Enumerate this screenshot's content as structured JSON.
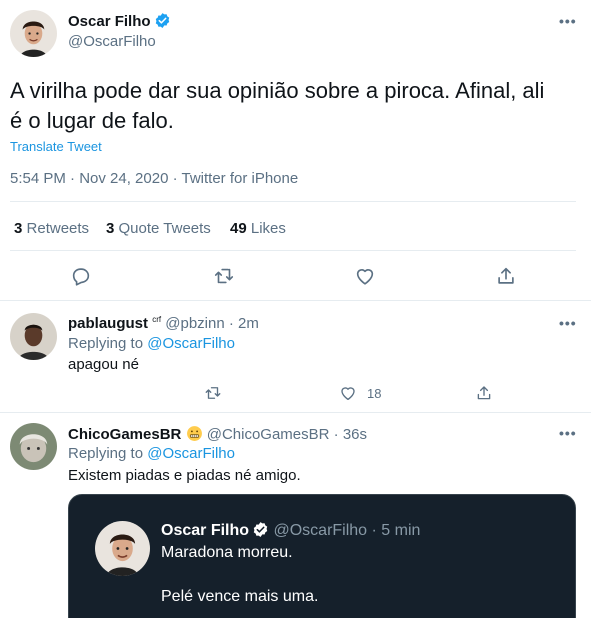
{
  "main_tweet": {
    "author_name": "Oscar Filho",
    "author_handle": "@OscarFilho",
    "text_line1": "A virilha pode dar sua opinião sobre a piroca. Afinal, ali",
    "text_line2": "é o lugar de falo.",
    "translate_label": "Translate Tweet",
    "timestamp": "5:54 PM · Nov 24, 2020 · Twitter for iPhone",
    "stats": {
      "retweets_count": "3",
      "retweets_label": "Retweets",
      "quote_count": "3",
      "quote_label": "Quote Tweets",
      "likes_count": "49",
      "likes_label": "Likes"
    }
  },
  "replies": [
    {
      "author_name": "pablaugust",
      "author_suffix": "crf",
      "author_handle": "@pbzinn",
      "time": "· 2m",
      "replying_prefix": "Replying to",
      "replying_handle": "@OscarFilho",
      "text": "apagou né",
      "like_count": "18"
    },
    {
      "author_name": "ChicoGamesBR",
      "author_handle": "@ChicoGamesBR",
      "time": "· 36s",
      "replying_prefix": "Replying to",
      "replying_handle": "@OscarFilho",
      "text": "Existem piadas e piadas né amigo.",
      "quoted": {
        "author_name": "Oscar Filho",
        "author_handle": "@OscarFilho",
        "time": "· 5 min",
        "line1": "Maradona morreu.",
        "line2": "Pelé vence mais uma."
      }
    }
  ],
  "icons": {
    "more": "more-icon",
    "reply": "reply-icon",
    "retweet": "retweet-icon",
    "like": "like-icon",
    "share": "share-icon",
    "verified": "verified-badge-icon",
    "emoji": "grimacing-emoji-icon"
  },
  "colors": {
    "accent": "#1b95e0",
    "muted": "#5b7083",
    "text": "#0f1419",
    "divider": "#e6ecf0",
    "dark_card": "#15202b"
  }
}
